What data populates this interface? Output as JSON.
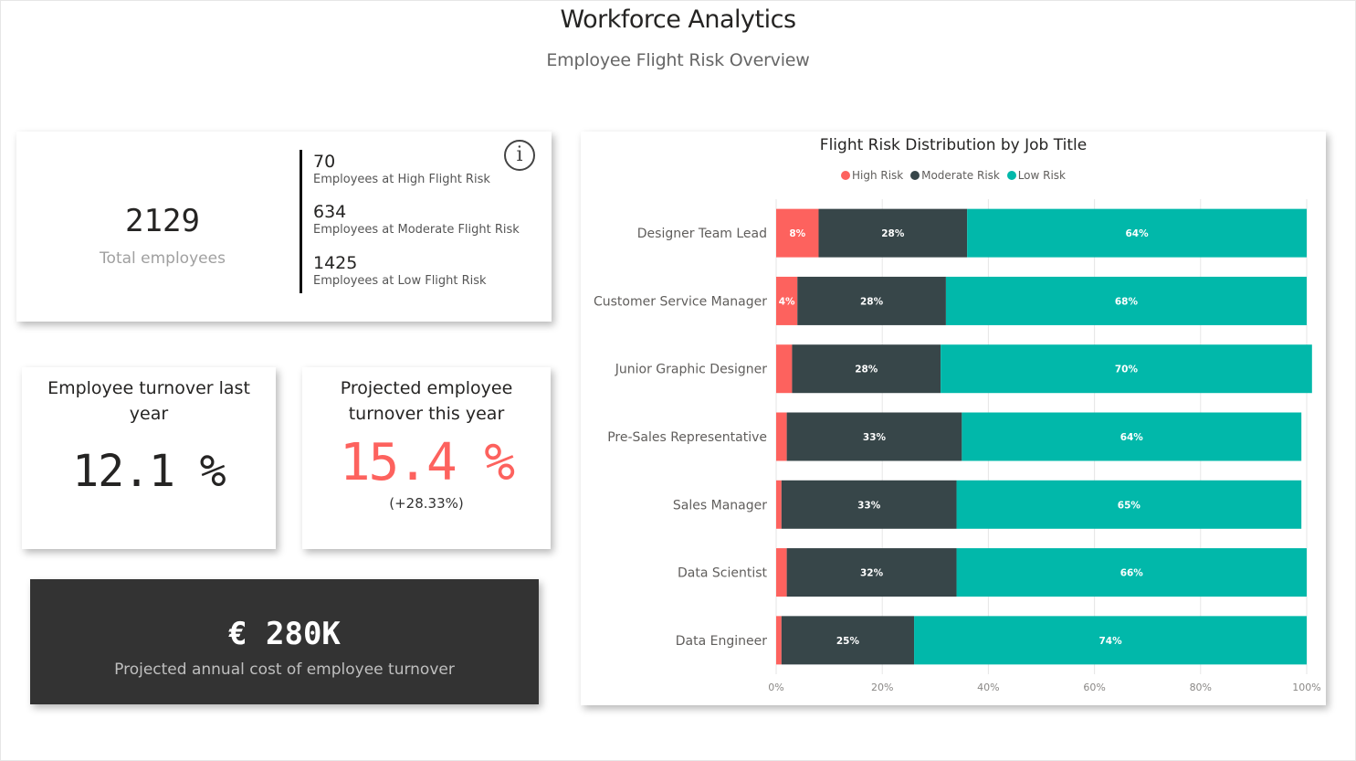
{
  "header": {
    "title": "Workforce Analytics",
    "subtitle": "Employee Flight Risk Overview"
  },
  "summary": {
    "total_value": "2129",
    "total_label": "Total employees",
    "info_icon": "info-circle-icon",
    "risks": [
      {
        "value": "70",
        "label": "Employees at High Flight Risk"
      },
      {
        "value": "634",
        "label": "Employees at Moderate Flight Risk"
      },
      {
        "value": "1425",
        "label": "Employees at Low Flight Risk"
      }
    ]
  },
  "turnover_last": {
    "title": "Employee turnover last year",
    "value": "12.1 %"
  },
  "turnover_projected": {
    "title": "Projected employee turnover this year",
    "value": "15.4 %",
    "delta": "(+28.33%)",
    "value_color": "#fd625e"
  },
  "cost": {
    "value": "€ 280K",
    "label": "Projected annual cost of employee turnover",
    "background": "#333333"
  },
  "chart_data": {
    "type": "bar",
    "orientation": "horizontal",
    "stacked": "100%",
    "title": "Flight Risk Distribution by Job Title",
    "legend_position": "top-center",
    "categories": [
      "Designer Team Lead",
      "Customer Service Manager",
      "Junior Graphic Designer",
      "Pre-Sales Representative",
      "Sales Manager",
      "Data Scientist",
      "Data Engineer"
    ],
    "series": [
      {
        "name": "High Risk",
        "color": "#fd625e",
        "values": [
          8,
          4,
          3,
          2,
          1,
          2,
          1
        ],
        "labels": [
          "8%",
          "4%",
          "",
          "",
          "",
          "",
          ""
        ]
      },
      {
        "name": "Moderate Risk",
        "color": "#374649",
        "values": [
          28,
          28,
          28,
          33,
          33,
          32,
          25
        ],
        "labels": [
          "28%",
          "28%",
          "28%",
          "33%",
          "33%",
          "32%",
          "25%"
        ]
      },
      {
        "name": "Low Risk",
        "color": "#01b8aa",
        "values": [
          64,
          68,
          70,
          64,
          65,
          66,
          74
        ],
        "labels": [
          "64%",
          "68%",
          "70%",
          "64%",
          "65%",
          "66%",
          "74%"
        ]
      }
    ],
    "xlim": [
      0,
      100
    ],
    "x_ticks": [
      "0%",
      "20%",
      "40%",
      "60%",
      "80%",
      "100%"
    ],
    "grid": true
  }
}
